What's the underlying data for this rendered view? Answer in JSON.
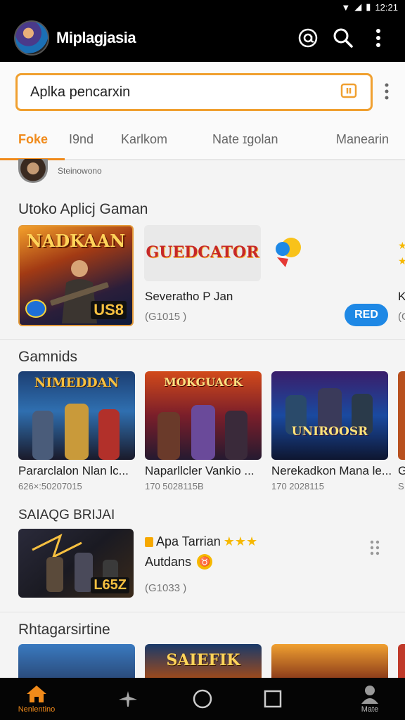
{
  "status_bar": {
    "time": "12:21"
  },
  "app_bar": {
    "title": "Miplagjasia"
  },
  "search": {
    "placeholder": "Aplka pencarxin"
  },
  "tabs": [
    {
      "label": "Foke",
      "active": true
    },
    {
      "label": "I9nd"
    },
    {
      "label": "Karlkom"
    },
    {
      "label": "Nate ɪgolan"
    },
    {
      "label": "Manearin"
    }
  ],
  "user": {
    "name": "Steinowono"
  },
  "section1": {
    "title": "Utoko Aplicj Gaman",
    "hero_title": "NADKAAN",
    "hero_badge": "US8",
    "card2_logo": "GUEDCATOR",
    "card2_name": "Severatho P Jan",
    "card2_sub": "(G1015 )",
    "card2_button": "RED",
    "partial_letter": "K",
    "partial_sub": "(G"
  },
  "section2": {
    "title": "Gamnids",
    "items": [
      {
        "overlay": "NIMEDDAN",
        "name": "Pararclalon Nlan  lc...",
        "sub": "626×:50207015"
      },
      {
        "overlay": "MOKGUACK",
        "name": "Naparllcler Vankio ...",
        "sub": "170 5028115B"
      },
      {
        "overlay": "UNIROOSR",
        "name": "Nerekadkon Mana le...",
        "sub": "170 2028115"
      }
    ],
    "partial_letter": "G",
    "partial_sub": "S"
  },
  "section3": {
    "title": "SAIAQG BRIJAI",
    "thumb_overlay": "L65Z",
    "app_name": "Apa Tarrian",
    "rating_stars": "★★★",
    "subtitle": "Autdans",
    "sub_icon": "♉",
    "meta": "(G1033 )"
  },
  "section4": {
    "title": "Rhtagarsirtine",
    "items": [
      {
        "overlay": ""
      },
      {
        "overlay": "SAIEFIK"
      },
      {
        "overlay": ""
      }
    ]
  },
  "bottom_nav": [
    {
      "label": "Nenlentino",
      "icon": "home-icon",
      "active": true
    },
    {
      "label": "",
      "icon": "plane-icon"
    },
    {
      "label": "",
      "icon": "circle-icon"
    },
    {
      "label": "",
      "icon": "square-icon"
    },
    {
      "label": "Mate",
      "icon": "person-icon"
    }
  ],
  "colors": {
    "accent": "#f08a1a",
    "button": "#1e88e5",
    "bar": "#000000"
  }
}
